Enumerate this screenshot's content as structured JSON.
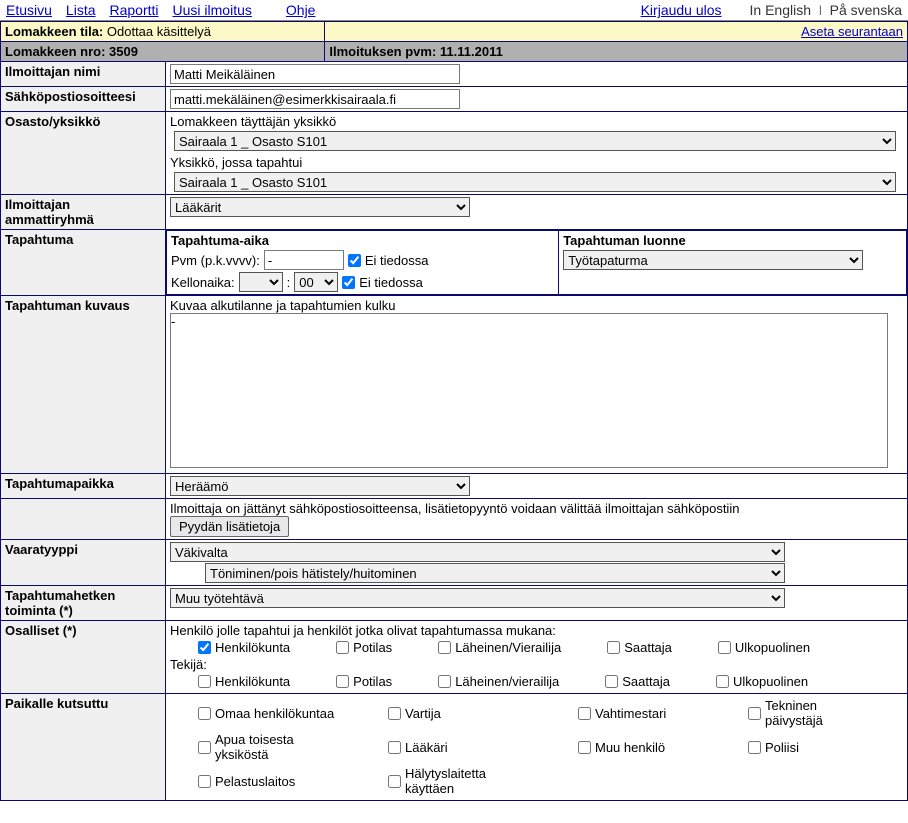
{
  "nav": {
    "etusivu": "Etusivu",
    "lista": "Lista",
    "raportti": "Raportti",
    "uusi": "Uusi ilmoitus",
    "ohje": "Ohje",
    "logout": "Kirjaudu ulos",
    "lang_en": "In English",
    "lang_sv": "På svenska"
  },
  "status": {
    "label": "Lomakkeen tila:",
    "value": "Odottaa käsittelyä",
    "followlink": "Aseta seurantaan"
  },
  "formno": {
    "label": "Lomakkeen nro:",
    "value": "3509",
    "datelabel": "Ilmoituksen pvm:",
    "datevalue": "11.11.2011"
  },
  "reporter": {
    "name_label": "Ilmoittajan nimi",
    "name_value": "Matti Meikäläinen",
    "email_label": "Sähköpostiosoitteesi",
    "email_value": "matti.mekäläinen@esimerkkisairaala.fi"
  },
  "unit": {
    "label": "Osasto/yksikkö",
    "filler_label": "Lomakkeen täyttäjän yksikkö",
    "filler_value": "Sairaala 1 _ Osasto S101",
    "happened_label": "Yksikkö, jossa tapahtui",
    "happened_value": "Sairaala 1 _ Osasto S101"
  },
  "prof": {
    "label": "Ilmoittajan ammattiryhmä",
    "value": "Lääkärit"
  },
  "event": {
    "label": "Tapahtuma",
    "time_head": "Tapahtuma-aika",
    "pvm_label": "Pvm (p.k.vvvv):",
    "pvm_value": "-",
    "unknown": "Ei tiedossa",
    "kello_label": "Kellonaika:",
    "kello_min": "00",
    "nature_head": "Tapahtuman luonne",
    "nature_value": "Työtapaturma"
  },
  "desc": {
    "label": "Tapahtuman kuvaus",
    "hint": "Kuvaa alkutilanne ja tapahtumien kulku",
    "value": "-"
  },
  "place": {
    "label": "Tapahtumapaikka",
    "value": "Heräämö"
  },
  "req": {
    "info": "Ilmoittaja on jättänyt sähköpostiosoitteensa, lisätietopyyntö voidaan välittää ilmoittajan sähköpostiin",
    "button": "Pyydän lisätietoja"
  },
  "danger": {
    "label": "Vaaratyyppi",
    "value1": "Väkivalta",
    "value2": "Töniminen/pois hätistely/huitominen"
  },
  "activity": {
    "label": "Tapahtumahetken toiminta (*)",
    "value": "Muu työtehtävä"
  },
  "parties": {
    "label": "Osalliset (*)",
    "h1": "Henkilö jolle tapahtui ja henkilöt jotka olivat tapahtumassa mukana:",
    "o1": "Henkilökunta",
    "o2": "Potilas",
    "o3": "Läheinen/Vierailija",
    "o4": "Saattaja",
    "o5": "Ulkopuolinen",
    "h2": "Tekijä:",
    "p1": "Henkilökunta",
    "p2": "Potilas",
    "p3": "Läheinen/vierailija",
    "p4": "Saattaja",
    "p5": "Ulkopuolinen"
  },
  "called": {
    "label": "Paikalle kutsuttu",
    "o1": "Omaa henkilökuntaa",
    "o2": "Vartija",
    "o3": "Vahtimestari",
    "o4": "Tekninen päivystäjä",
    "o5": "Apua toisesta yksiköstä",
    "o6": "Lääkäri",
    "o7": "Muu henkilö",
    "o8": "Poliisi",
    "o9": "Pelastuslaitos",
    "o10": "Hälytyslaitetta käyttäen"
  }
}
